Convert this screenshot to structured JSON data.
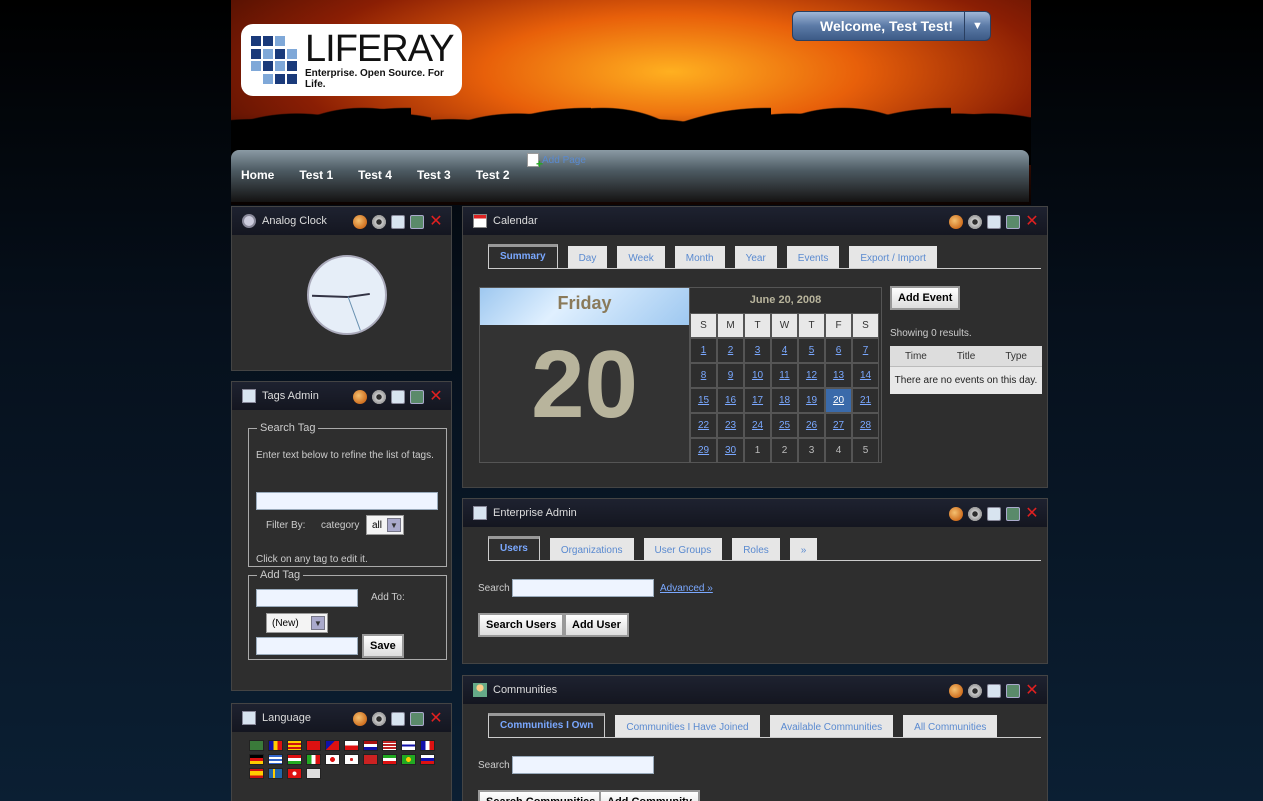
{
  "header": {
    "logo_name": "LIFERAY",
    "logo_tagline": "Enterprise. Open Source. For Life.",
    "welcome": "Welcome, Test Test!",
    "welcome_arrow": "▼",
    "add_page": "Add Page",
    "nav": [
      "Home",
      "Test 1",
      "Test 4",
      "Test 3",
      "Test 2"
    ]
  },
  "clock": {
    "title": "Analog Clock"
  },
  "tags": {
    "title": "Tags Admin",
    "search_legend": "Search Tag",
    "search_hint": "Enter text below to refine the list of tags.",
    "filter_by": "Filter By:",
    "filter_label": "category",
    "filter_value": "all",
    "click_hint": "Click on any tag to edit it.",
    "add_legend": "Add Tag",
    "add_to": "Add To:",
    "add_to_value": "(New)",
    "save": "Save"
  },
  "language": {
    "title": "Language"
  },
  "calendar": {
    "title": "Calendar",
    "tabs": [
      "Summary",
      "Day",
      "Week",
      "Month",
      "Year",
      "Events",
      "Export / Import"
    ],
    "weekday": "Friday",
    "day": "20",
    "month_title": "June 20, 2008",
    "weekdays": [
      "S",
      "M",
      "T",
      "W",
      "T",
      "F",
      "S"
    ],
    "weeks": [
      [
        "1",
        "2",
        "3",
        "4",
        "5",
        "6",
        "7"
      ],
      [
        "8",
        "9",
        "10",
        "11",
        "12",
        "13",
        "14"
      ],
      [
        "15",
        "16",
        "17",
        "18",
        "19",
        "20",
        "21"
      ],
      [
        "22",
        "23",
        "24",
        "25",
        "26",
        "27",
        "28"
      ],
      [
        "29",
        "30",
        "1",
        "2",
        "3",
        "4",
        "5"
      ]
    ],
    "add_event": "Add Event",
    "results": "Showing 0 results.",
    "cols": [
      "Time",
      "Title",
      "Type"
    ],
    "empty": "There are no events on this day."
  },
  "enterprise": {
    "title": "Enterprise Admin",
    "tabs": [
      "Users",
      "Organizations",
      "User Groups",
      "Roles",
      "»"
    ],
    "search_label": "Search",
    "advanced": "Advanced »",
    "search_btn": "Search Users",
    "add_btn": "Add User"
  },
  "communities": {
    "title": "Communities",
    "tabs": [
      "Communities I Own",
      "Communities I Have Joined",
      "Available Communities",
      "All Communities"
    ],
    "search_label": "Search",
    "search_btn": "Search Communities",
    "add_btn": "Add Community"
  },
  "colors": {
    "accent": "#7aa8ff",
    "close": "#e02020",
    "today": "#3a6aaa"
  }
}
